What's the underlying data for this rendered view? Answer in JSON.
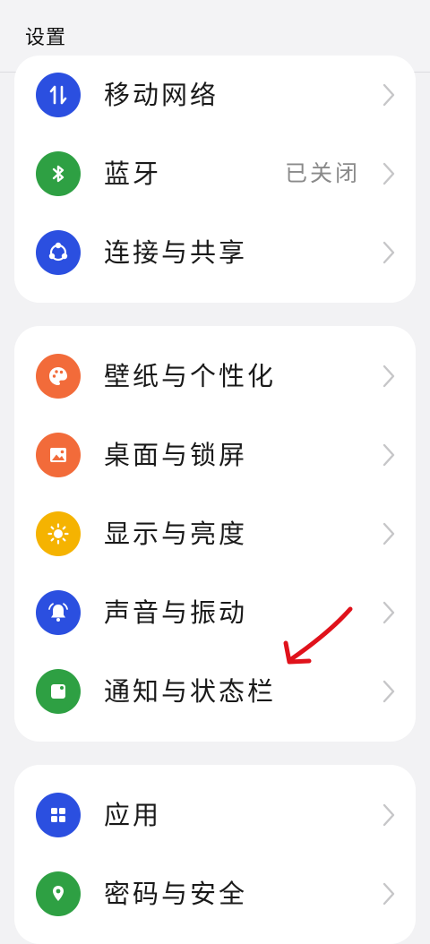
{
  "header": {
    "title": "设置"
  },
  "groups": [
    {
      "items": [
        {
          "label": "移动网络",
          "value": "",
          "icon": "mobile-data-icon",
          "color": "#2b4fe0"
        },
        {
          "label": "蓝牙",
          "value": "已关闭",
          "icon": "bluetooth-icon",
          "color": "#2ea043"
        },
        {
          "label": "连接与共享",
          "value": "",
          "icon": "share-icon",
          "color": "#2b4fe0"
        }
      ]
    },
    {
      "items": [
        {
          "label": "壁纸与个性化",
          "value": "",
          "icon": "palette-icon",
          "color": "#f26b3a"
        },
        {
          "label": "桌面与锁屏",
          "value": "",
          "icon": "image-icon",
          "color": "#f26b3a"
        },
        {
          "label": "显示与亮度",
          "value": "",
          "icon": "sun-icon",
          "color": "#f5b301"
        },
        {
          "label": "声音与振动",
          "value": "",
          "icon": "bell-icon",
          "color": "#2b4fe0"
        },
        {
          "label": "通知与状态栏",
          "value": "",
          "icon": "notification-icon",
          "color": "#2ea043"
        }
      ]
    },
    {
      "items": [
        {
          "label": "应用",
          "value": "",
          "icon": "apps-grid-icon",
          "color": "#2b4fe0"
        },
        {
          "label": "密码与安全",
          "value": "",
          "icon": "location-shield-icon",
          "color": "#2ea043"
        }
      ]
    }
  ],
  "annotation": {
    "color": "#e0121b",
    "icon": "red-arrow-annotation"
  }
}
